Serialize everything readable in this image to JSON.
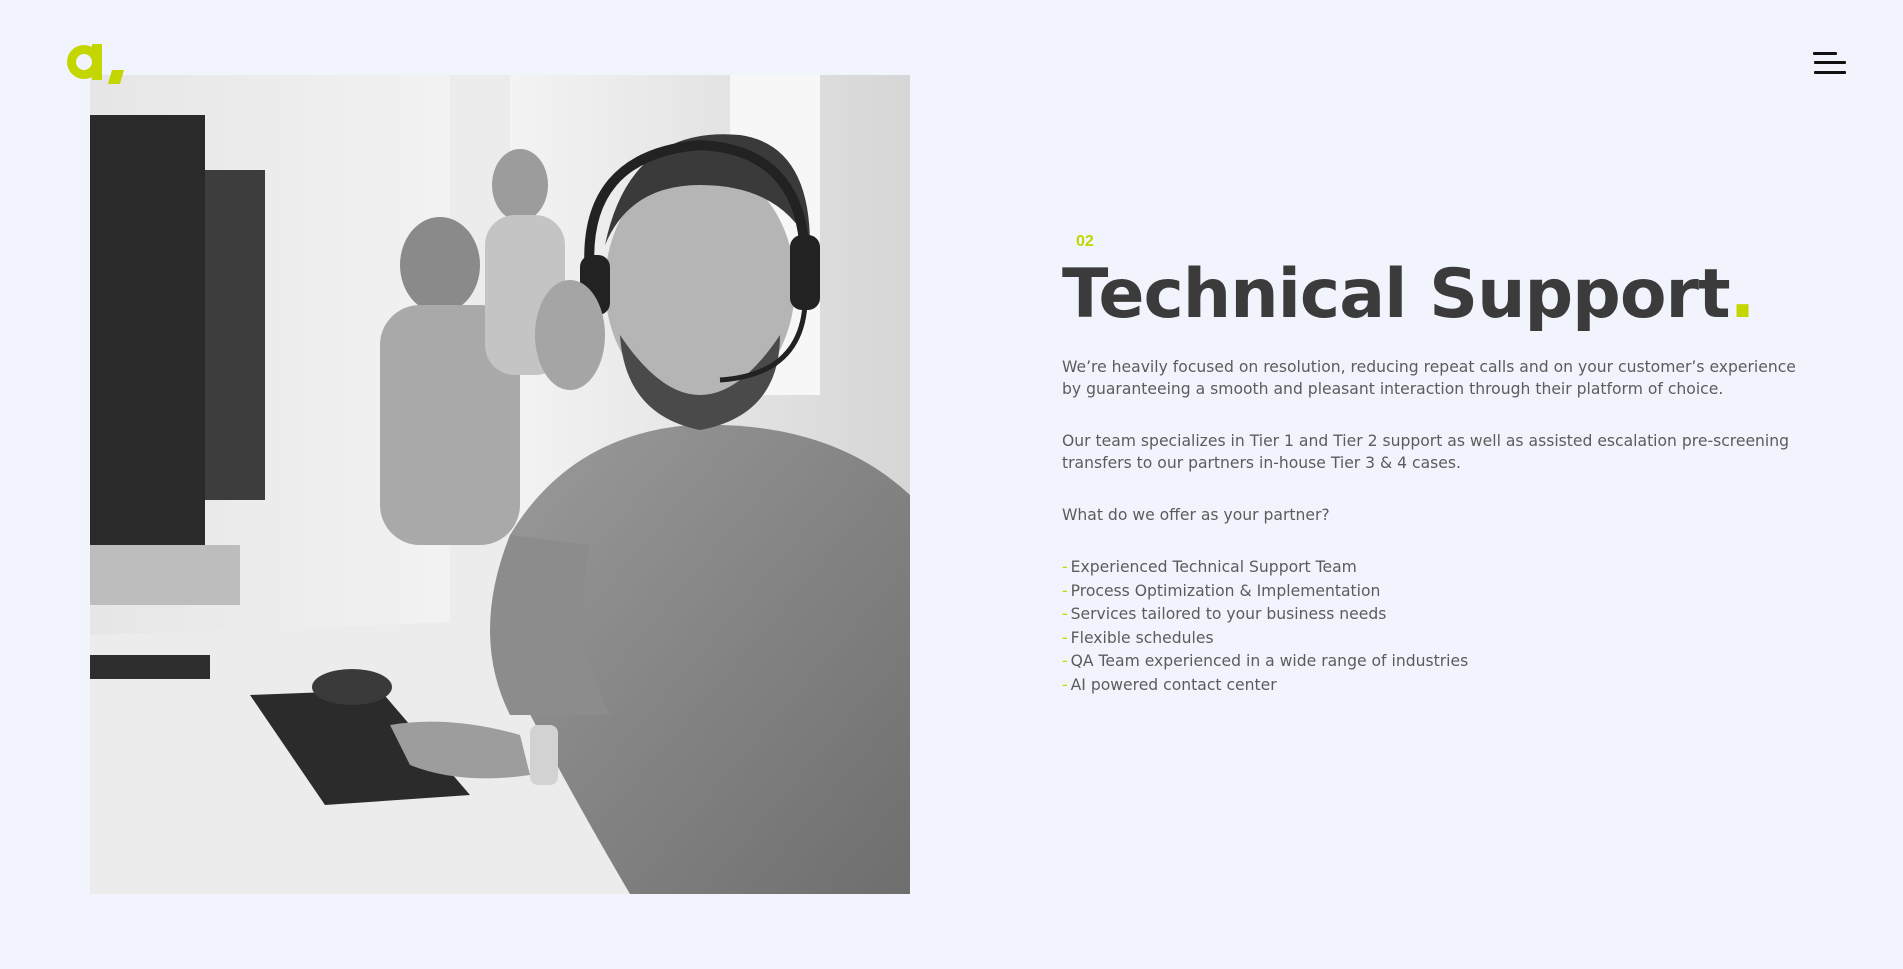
{
  "brand": {
    "accent_color": "#c3d600",
    "logo_letter": "a",
    "logo_name": "brand-logo"
  },
  "header": {
    "menu_icon": "hamburger-menu-icon"
  },
  "hero_image": {
    "description_icon": "support-agent-photo"
  },
  "section": {
    "number": "02",
    "title": "Technical Support",
    "title_dot": ".",
    "paragraphs": [
      "We’re heavily focused on resolution, reducing repeat calls and on your customer’s experience by guaranteeing a smooth and pleasant interaction through their platform of choice.",
      "Our team specializes in Tier 1 and Tier 2 support as well as assisted escalation pre-screening transfers to our partners in-house Tier 3 & 4 cases.",
      "What do we offer as your partner?"
    ],
    "list_bullet": "-",
    "offers": [
      "Experienced Technical Support Team",
      "Process Optimization & Implementation",
      "Services tailored to your business needs",
      "Flexible schedules",
      "QA Team experienced in a wide range of industries",
      "AI powered contact center"
    ]
  }
}
